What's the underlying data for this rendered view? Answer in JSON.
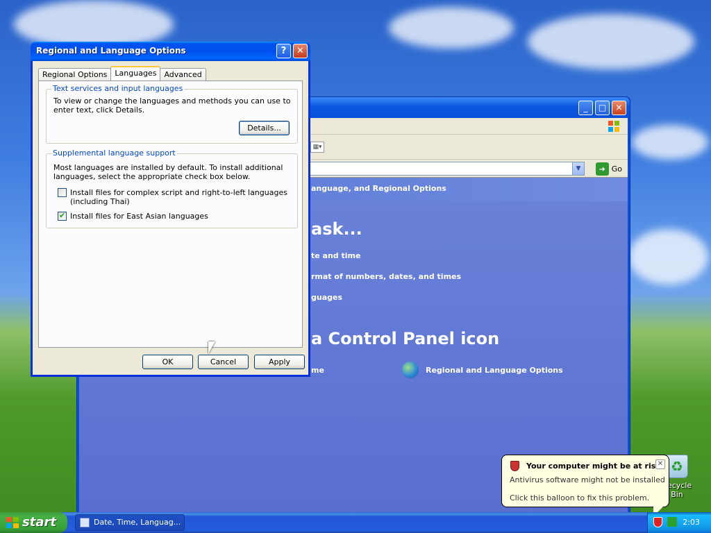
{
  "dialog": {
    "title": "Regional and Language Options",
    "help_label": "?",
    "close_label": "✕",
    "tabs": [
      {
        "label": "Regional Options"
      },
      {
        "label": "Languages"
      },
      {
        "label": "Advanced"
      }
    ],
    "active_tab": "Languages",
    "text_services": {
      "legend": "Text services and input languages",
      "description": "To view or change the languages and methods you can use to enter text, click Details.",
      "details_label": "Details..."
    },
    "supplemental": {
      "legend": "Supplemental language support",
      "description": "Most languages are installed by default. To install additional languages, select the appropriate check box below.",
      "complex_label": "Install files for complex script and right-to-left languages (including Thai)",
      "complex_checked": false,
      "east_asian_label": "Install files for East Asian languages",
      "east_asian_checked": true
    },
    "buttons": {
      "ok": "OK",
      "cancel": "Cancel",
      "apply": "Apply"
    }
  },
  "control_panel": {
    "go_label": "Go",
    "header_text": "anguage, and Regional Options",
    "pick_task_heading": "ask...",
    "tasks": [
      "te and time",
      "rmat of numbers, dates, and times",
      "guages"
    ],
    "icon_heading": "a Control Panel icon",
    "icons": [
      {
        "label": "me"
      },
      {
        "label": "Regional and Language Options"
      }
    ]
  },
  "balloon": {
    "title": "Your computer might be at risk",
    "line1": "Antivirus software might not be installed",
    "line2": "Click this balloon to fix this problem."
  },
  "desktop": {
    "recycle_bin": "Recycle Bin"
  },
  "taskbar": {
    "start_label": "start",
    "task_label": "Date, Time, Languag...",
    "clock": "2:03"
  }
}
